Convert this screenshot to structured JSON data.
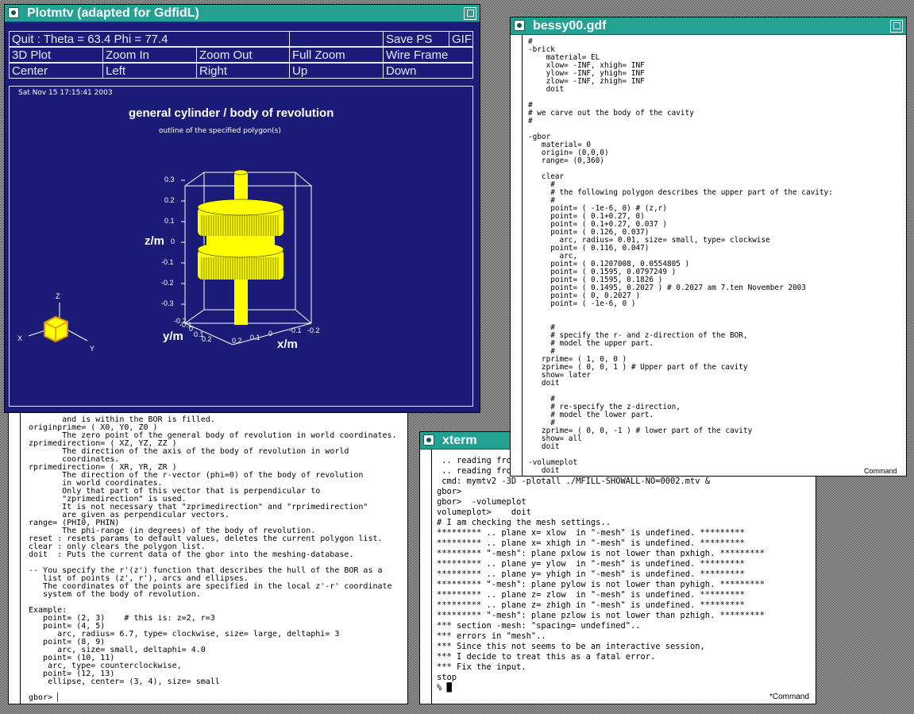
{
  "colors": {
    "titlebar": "#23a193",
    "plot_bg": "#1b1b78",
    "cylinder": "#ffff00"
  },
  "plotmtv": {
    "title": "Plotmtv (adapted for GdfidL)",
    "row1": [
      "Quit :  Theta = 63.4   Phi = 77.4",
      "",
      "Save PS",
      "GIF"
    ],
    "row2": [
      "3D Plot",
      "Zoom In",
      "Zoom Out",
      "Full Zoom",
      "Wire Frame"
    ],
    "row3": [
      "Center",
      "Left",
      "Right",
      "Up",
      "Down"
    ],
    "date": "Sat Nov 15 17:15:41 2003",
    "plot_title": "general cylinder / body of revolution",
    "plot_subtitle": "outline of the specified polygon(s)",
    "z_label": "z/m",
    "y_label": "y/m",
    "x_label": "x/m",
    "z_ticks": [
      "0.3",
      "0.2",
      "0.1",
      "0",
      "-0.1",
      "-0.2",
      "-0.3"
    ],
    "y_ticks": [
      "0.2",
      "0.1",
      "0",
      "-0.1",
      "-0.2"
    ],
    "x_ticks": [
      "0.2",
      "0.1",
      "0",
      "-0.1",
      "-0.2"
    ],
    "triad": {
      "z": "Z",
      "x": "X",
      "y": "Y"
    }
  },
  "bessy": {
    "title": "bessy00.gdf",
    "content": "#\n-brick\n    material= EL\n    xlow= -INF, xhigh= INF\n    ylow= -INF, yhigh= INF\n    zlow= -INF, zhigh= INF\n    doit\n\n#\n# we carve out the body of the cavity\n#\n\n-gbor\n   material= 0\n   origin= (0,0,0)\n   range= (0,360)\n\n   clear\n     #\n     # the following polygon describes the upper part of the cavity:\n     #\n     point= ( -1e-6, 0) # (z,r)\n     point= ( 0.1+0.27, 0)\n     point= ( 0.1+0.27, 0.037 )\n     point= ( 0.126, 0.037)\n       arc, radius= 0.01, size= small, type= clockwise\n     point= ( 0.116, 0.047)\n       arc,\n     point= ( 0.1207008, 0.0554805 )\n     point= ( 0.1595, 0.0797249 )\n     point= ( 0.1595, 0.1826 )\n     point= ( 0.1495, 0.2027 ) # 0.2027 am 7.ten November 2003\n     point= ( 0, 0.2027 )\n     point= ( -1e-6, 0 )\n\n\n     #\n     # specify the r- and z-direction of the BOR,\n     # model the upper part.\n     #\n   rprime= ( 1, 0, 0 )\n   zprime= ( 0, 0, 1 ) # Upper part of the cavity\n   show= later\n   doit\n\n     #\n     # re-specify the z-direction,\n     # model the lower part.\n     #\n   zprime= ( 0, 0, -1 ) # lower part of the cavity\n   show= all\n   doit\n\n-volumeplot\n   doit",
    "status": "Command"
  },
  "help_term": {
    "content": "       and is within the BOR is filled.\noriginprime= ( X0, Y0, Z0 )\n       The zero point of the general body of revolution in world coordinates.\nzprimedirection= ( XZ, YZ, ZZ )\n       The direction of the axis of the body of revolution in world\n       coordinates.\nrprimedirection= ( XR, YR, ZR )\n       The direction of the r-vector (phi=0) of the body of revolution\n       in world coordinates.\n       Only that part of this vector that is perpendicular to\n       \"zprimedirection\" is used.\n       It is not necessary that \"zprimedirection\" and \"rprimedirection\"\n       are given as perpendicular vectors.\nrange= (PHI0, PHIN)\n       The phi-range (in degrees) of the body of revolution.\nreset : resets params to default values, deletes the current polygon list.\nclear : only clears the polygon list.\ndoit  : Puts the current data of the gbor into the meshing-database.\n\n-- You specify the r'(z') function that describes the hull of the BOR as a\n   list of points (z', r'), arcs and ellipses.\n   The coordinates of the points are specified in the local z'-r' coordinate\n   system of the body of revolution.\n\nExample:\n   point= (2, 3)    # this is: z=2, r=3\n   point= (4, 5)\n      arc, radius= 6.7, type= clockwise, size= large, deltaphi= 3\n   point= (8, 9)\n      arc, size= small, deltaphi= 4.0\n   point= (10, 11)\n    arc, type= counterclockwise,\n   point= (12, 13)\n    ellipse, center= (3, 4), size= small\n\ngbor> ▏"
  },
  "xterm": {
    "title": "xterm",
    "content": " .. reading fro\n .. reading fro\n cmd: mymtv2 -3D -plotall ./MFILL-SHOWALL-NO=0002.mtv &\ngbor>\ngbor>  -volumeplot\nvolumeplot>    doit\n# I am checking the mesh settings..\n********* .. plane x= xlow  in \"-mesh\" is undefined. *********\n********* .. plane x= xhigh in \"-mesh\" is undefined. *********\n********* \"-mesh\": plane pxlow is not lower than pxhigh. *********\n********* .. plane y= ylow  in \"-mesh\" is undefined. *********\n********* .. plane y= yhigh in \"-mesh\" is undefined. *********\n********* \"-mesh\": plane pylow is not lower than pyhigh. *********\n********* .. plane z= zlow  in \"-mesh\" is undefined. *********\n********* .. plane z= zhigh in \"-mesh\" is undefined. *********\n********* \"-mesh\": plane pzlow is not lower than pzhigh. *********\n*** section -mesh: \"spacing= undefined\"..\n*** errors in \"mesh\"..\n*** Since this not seems to be an interactive session,\n*** I decide to treat this as a fatal error.\n*** Fix the input.\nstop\n% █",
    "status": "*Command"
  }
}
